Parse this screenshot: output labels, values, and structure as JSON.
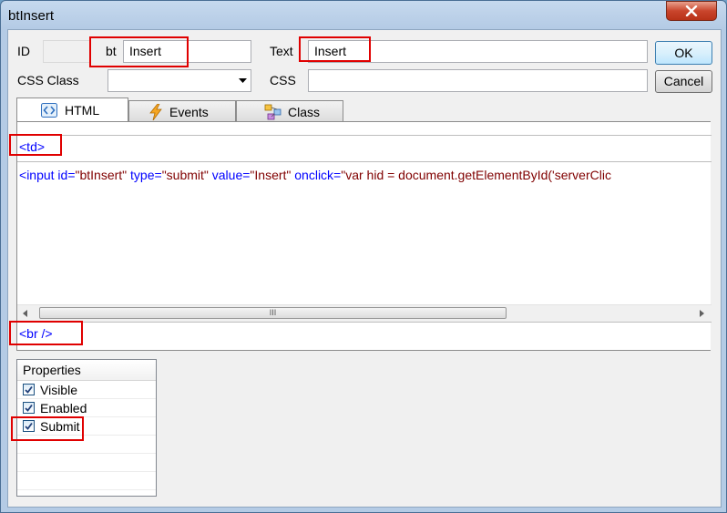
{
  "window": {
    "title": "btInsert"
  },
  "form": {
    "id_label": "ID",
    "id_prefix": "bt",
    "id_value": "Insert",
    "text_label": "Text",
    "text_value": "Insert",
    "css_class_label": "CSS Class",
    "css_class_value": "",
    "css_label": "CSS",
    "css_value": ""
  },
  "buttons": {
    "ok": "OK",
    "cancel": "Cancel"
  },
  "tabs": [
    {
      "label": "HTML",
      "icon": "html-tag-icon",
      "active": true
    },
    {
      "label": "Events",
      "icon": "lightning-icon",
      "active": false
    },
    {
      "label": "Class",
      "icon": "class-diagram-icon",
      "active": false
    }
  ],
  "code": {
    "before": "<td>",
    "main_line": {
      "open": "<",
      "tag": "input",
      "a1": " id=",
      "v1": "\"btInsert\"",
      "a2": " type=",
      "v2": "\"submit\"",
      "a3": " value=",
      "v3": "\"Insert\"",
      "a4": " onclick=",
      "v4": "\"var hid = document.getElementById('serverClic"
    },
    "after": "<br />",
    "scroll_grip": "III"
  },
  "properties": {
    "header": "Properties",
    "items": [
      {
        "label": "Visible",
        "checked": true
      },
      {
        "label": "Enabled",
        "checked": true
      },
      {
        "label": "Submit",
        "checked": true
      }
    ]
  },
  "colors": {
    "highlight_box": "#e00000",
    "tag": "#0000ff",
    "attr_value": "#800000"
  }
}
